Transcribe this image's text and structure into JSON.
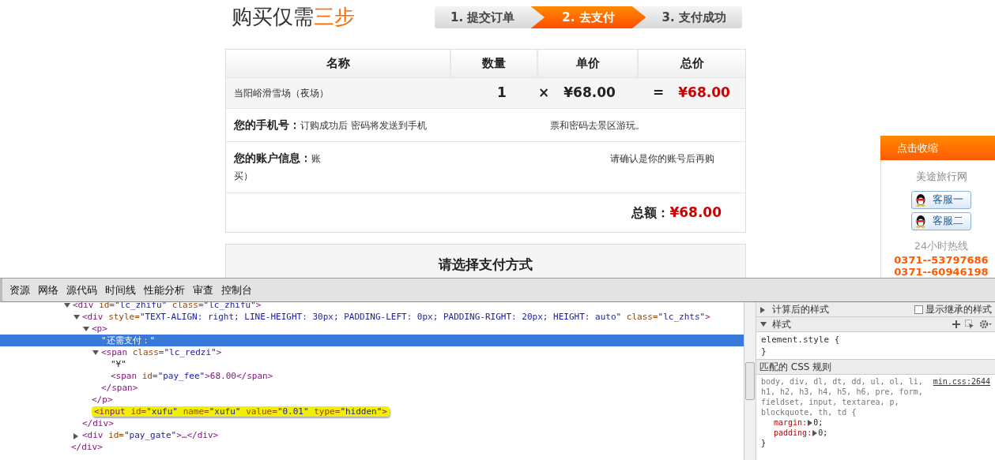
{
  "page": {
    "heading": {
      "text": "购买仅需",
      "accent": "三步"
    },
    "steps": [
      {
        "label": "1. 提交订单",
        "selected": false
      },
      {
        "label": "2. 去支付",
        "selected": true
      },
      {
        "label": "3. 支付成功",
        "selected": false
      }
    ],
    "order_table": {
      "columns": [
        "名称",
        "数量",
        "单价",
        "总价"
      ],
      "row": {
        "name": "当阳峪滑雪场（夜场）",
        "quantity": "1",
        "times": "×",
        "unit_price": "¥68.00",
        "equals": "=",
        "total": "¥68.00"
      }
    },
    "phone": {
      "label": "您的手机号：",
      "texts": [
        "订购成功后 密码将发送到手机",
        "票和密码去景区游玩。"
      ]
    },
    "account": {
      "label": "您的账户信息：",
      "texts": [
        "账",
        "请确认是你的账号后再购",
        "买）"
      ]
    },
    "total": {
      "label": "总额：",
      "amount": "¥68.00"
    },
    "payment_title": "请选择支付方式"
  },
  "sidebar": {
    "header": "点击收缩",
    "site": "美途旅行网",
    "buttons": [
      "客服一",
      "客服二"
    ],
    "hotline_label": "24小时热线",
    "phones": [
      "0371--53797686",
      "0371--60946198"
    ]
  },
  "devtools": {
    "tabs": [
      "资源",
      "网络",
      "源代码",
      "时间线",
      "性能分析",
      "审查",
      "控制台"
    ],
    "dom_tree": [
      {
        "kind": "element",
        "text": "<div id=\"lc_zhifu\" class=\"lc_zhifu\">",
        "expanded": true,
        "selected": false,
        "children": [
          {
            "kind": "element",
            "text": "<div style=\"TEXT-ALIGN: right; LINE-HEIGHT: 30px; PADDING-LEFT: 0px; PADDING-RIGHT: 20px; HEIGHT: auto\" class=\"lc_zhts\">",
            "expanded": true,
            "selected": false,
            "close": "</div>",
            "children": [
              {
                "kind": "element",
                "text": "<p>",
                "expanded": true,
                "selected": false,
                "close": "</p>",
                "children": [
                  {
                    "kind": "text",
                    "text": "\"还需支付：\"",
                    "selected": true
                  },
                  {
                    "kind": "element",
                    "text": "<span class=\"lc_redzi\">",
                    "expanded": true,
                    "selected": false,
                    "close": "</span>",
                    "children": [
                      {
                        "kind": "text",
                        "text": "\"¥\"",
                        "selected": false
                      },
                      {
                        "kind": "element",
                        "text": "<span id=\"pay_fee\">68.00</span>",
                        "selected": false
                      }
                    ]
                  }
                ]
              },
              {
                "kind": "match",
                "text": "<input id=\"xufu\" name=\"xufu\" value=\"0.01\" type=\"hidden\">",
                "selected": false
              }
            ]
          },
          {
            "kind": "element",
            "text": "<div id=\"pay_gate\">…</div>",
            "expanded": false,
            "selected": false
          }
        ]
      }
    ],
    "dom_tail": "</div>",
    "styles": {
      "computed": {
        "title": "计算后的样式",
        "expanded": false,
        "checkbox_label": "显示继承的样式",
        "checked": false
      },
      "styles_section": {
        "title": "样式",
        "expanded": true
      },
      "element_style": [
        "element.style {",
        "}"
      ],
      "matched_title": "匹配的 CSS 规则",
      "rule": {
        "selector": "body, div, dl, dt, dd, ul, ol, li, h1, h2, h3, h4, h5, h6, pre, form, fieldset, input, textarea, p, blockquote, th, td {",
        "source": "min.css:2644",
        "properties": [
          {
            "name": "margin:",
            "value": "0;"
          },
          {
            "name": "padding:",
            "value": "0;"
          }
        ],
        "close": "}"
      }
    }
  }
}
